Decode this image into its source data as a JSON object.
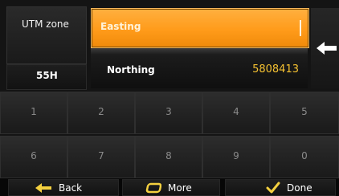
{
  "fields": {
    "utm_zone_label": "UTM zone",
    "utm_zone_value": "55H",
    "easting_label": "Easting",
    "easting_value": "",
    "northing_label": "Northing",
    "northing_value": "5808413"
  },
  "keypad": {
    "keys": [
      "1",
      "2",
      "3",
      "4",
      "5",
      "6",
      "7",
      "8",
      "9",
      "0"
    ]
  },
  "bottom_buttons": {
    "back": "Back",
    "more": "More",
    "done": "Done"
  },
  "colors": {
    "accent": "#ff9b1a",
    "value_yellow": "#f5c131",
    "background": "#141414"
  },
  "icons": {
    "back": "arrow-left-icon",
    "more": "rounded-square-icon",
    "done": "checkmark-icon",
    "field_arrow": "arrow-left-icon"
  }
}
